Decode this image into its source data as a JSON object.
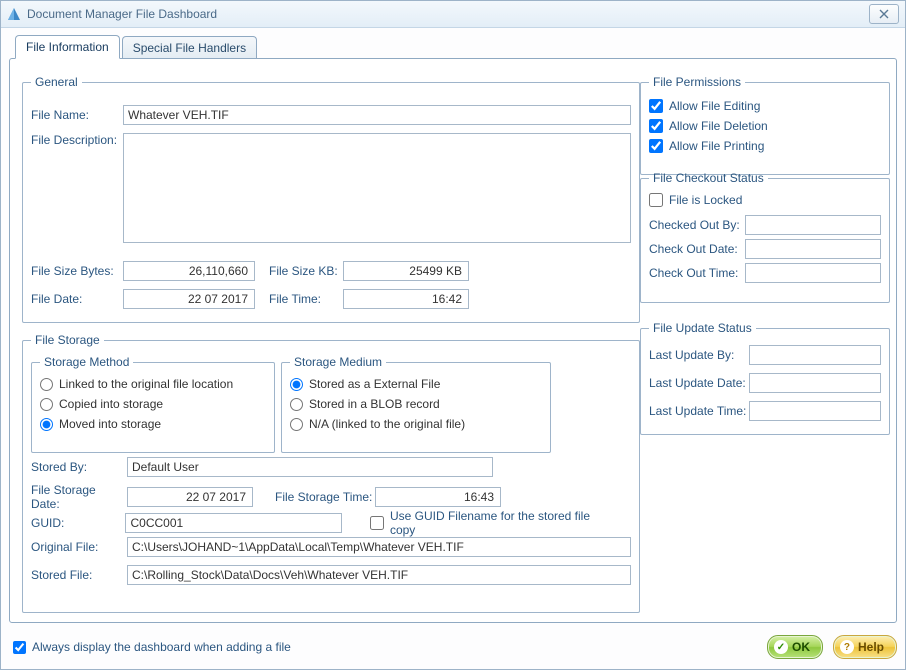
{
  "window": {
    "title": "Document Manager File Dashboard"
  },
  "tabs": [
    {
      "label": "File Information"
    },
    {
      "label": "Special File Handlers"
    }
  ],
  "general": {
    "legend": "General",
    "file_name_label": "File Name:",
    "file_name": "Whatever VEH.TIF",
    "file_desc_label": "File Description:",
    "file_desc": "",
    "file_size_bytes_label": "File Size Bytes:",
    "file_size_bytes": "26,110,660",
    "file_size_kb_label": "File Size KB:",
    "file_size_kb": "25499 KB",
    "file_date_label": "File Date:",
    "file_date": "22 07 2017",
    "file_time_label": "File Time:",
    "file_time": "16:42"
  },
  "permissions": {
    "legend": "File Permissions",
    "allow_edit": "Allow File Editing",
    "allow_delete": "Allow File Deletion",
    "allow_print": "Allow File Printing"
  },
  "checkout": {
    "legend": "File Checkout Status",
    "locked": "File is Locked",
    "by_label": "Checked Out By:",
    "by": "",
    "date_label": "Check Out Date:",
    "date": "",
    "time_label": "Check Out Time:",
    "time": ""
  },
  "update": {
    "legend": "File Update Status",
    "by_label": "Last Update By:",
    "by": "",
    "date_label": "Last Update Date:",
    "date": "",
    "time_label": "Last Update Time:",
    "time": ""
  },
  "storage": {
    "legend": "File Storage",
    "method_legend": "Storage Method",
    "method": {
      "linked": "Linked to the original file location",
      "copied": "Copied into storage",
      "moved": "Moved into storage"
    },
    "medium_legend": "Storage Medium",
    "medium": {
      "external": "Stored as a External File",
      "blob": "Stored in a BLOB record",
      "na": "N/A (linked to the original file)"
    },
    "stored_by_label": "Stored By:",
    "stored_by": "Default User",
    "storage_date_label": "File Storage Date:",
    "storage_date": "22 07 2017",
    "storage_time_label": "File Storage Time:",
    "storage_time": "16:43",
    "guid_label": "GUID:",
    "guid": "C0CC001",
    "use_guid_label": "Use GUID Filename for the stored file copy",
    "orig_label": "Original File:",
    "orig": "C:\\Users\\JOHAND~1\\AppData\\Local\\Temp\\Whatever VEH.TIF",
    "stored_label": "Stored File:",
    "stored": "C:\\Rolling_Stock\\Data\\Docs\\Veh\\Whatever VEH.TIF"
  },
  "footer": {
    "always_display": "Always display the dashboard when adding a file",
    "ok": "OK",
    "help": "Help"
  }
}
